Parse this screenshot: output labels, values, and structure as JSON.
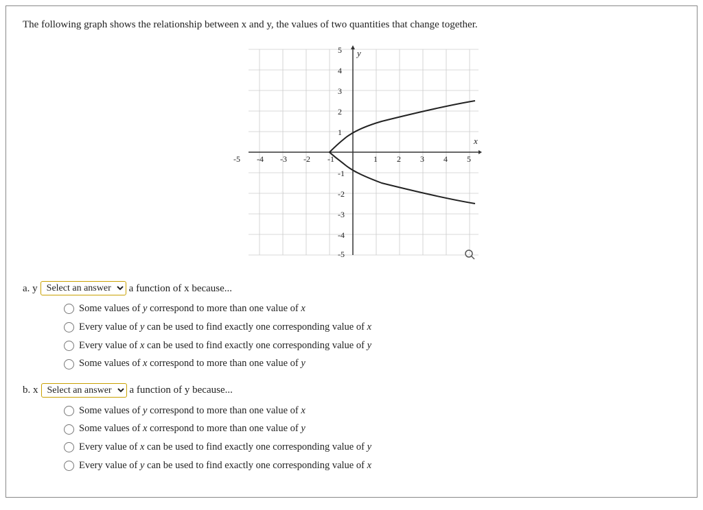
{
  "intro": "The following graph shows the relationship between x and y, the values of two quantities that change together.",
  "graph": {
    "xMin": -5,
    "xMax": 5,
    "yMin": -5,
    "yMax": 5,
    "xLabel": "x",
    "yLabel": "y"
  },
  "partA": {
    "label_before": "a. y",
    "dropdown_placeholder": "Select an answer",
    "label_after": "a function of x because...",
    "options": [
      "Some values of y correspond to more than one value of x",
      "Every value of y can be used to find exactly one corresponding value of x",
      "Every value of x can be used to find exactly one corresponding value of y",
      "Some values of x correspond to more than one value of y"
    ]
  },
  "partB": {
    "label_before": "b. x",
    "dropdown_placeholder": "Select an answer",
    "label_after": "a function of y because...",
    "options": [
      "Some values of y correspond to more than one value of x",
      "Some values of x correspond to more than one value of y",
      "Every value of x can be used to find exactly one corresponding value of y",
      "Every value of y can be used to find exactly one corresponding value of x"
    ]
  }
}
